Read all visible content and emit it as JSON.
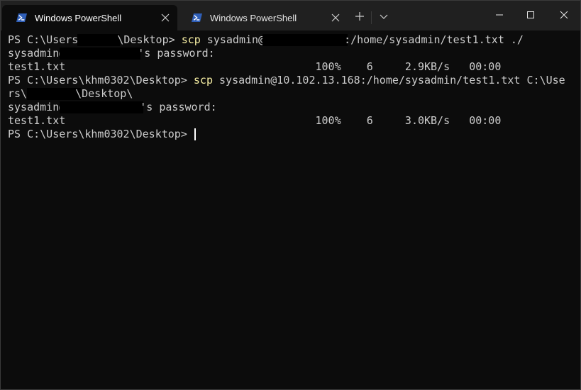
{
  "tabs": [
    {
      "title": "Windows PowerShell",
      "active": true
    },
    {
      "title": "Windows PowerShell",
      "active": false
    }
  ],
  "icons": {
    "powershell": "powershell-icon",
    "close": "close-icon",
    "new_tab": "plus-icon",
    "dropdown": "chevron-down-icon",
    "minimize": "minimize-icon",
    "maximize": "maximize-icon",
    "window_close": "close-icon"
  },
  "colors": {
    "background": "#0c0c0c",
    "titlebar": "#202020",
    "text": "#cccccc",
    "command": "#f9f1a5",
    "powershell_icon": "#2f5fb8"
  },
  "terminal": {
    "line1": {
      "prompt_a": "PS C:\\Users\\",
      "prompt_b": "\\Desktop> ",
      "command": "scp",
      "args_a": " sysadmin@",
      "args_b": ":/home/sysadmin/test1.txt ./"
    },
    "line2": {
      "user": "sysadmin@",
      "rest": "'s password:"
    },
    "line3": {
      "text": "test1.txt                                       100%    6     2.9KB/s   00:00"
    },
    "line4": {
      "prompt": "PS C:\\Users\\khm0302\\Desktop> ",
      "command": "scp",
      "args": " sysadmin@10.102.13.168:/home/sysadmin/test1.txt C:\\Use"
    },
    "line5": {
      "text_a": "rs\\",
      "text_b": "\\Desktop\\"
    },
    "line6": {
      "user": "sysadmin@",
      "rest": "'s password:"
    },
    "line7": {
      "text": "test1.txt                                       100%    6     3.0KB/s   00:00"
    },
    "line8": {
      "prompt": "PS C:\\Users\\khm0302\\Desktop> "
    }
  }
}
